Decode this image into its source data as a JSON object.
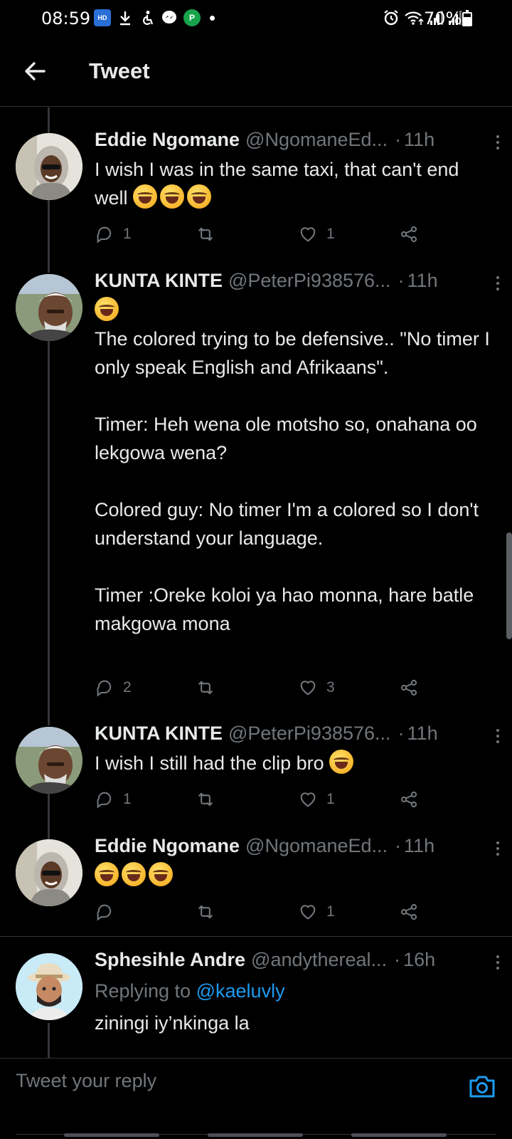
{
  "status_bar": {
    "time": "08:59",
    "app_icons": [
      "hd-movies-icon",
      "download-icon",
      "accessibility-icon",
      "messenger-icon",
      "p-app-icon"
    ],
    "battery": "70%",
    "battery_level": 0.7
  },
  "header": {
    "back_icon": "arrow-left-icon",
    "title": "Tweet"
  },
  "tweets": [
    {
      "name": "Eddie Ngomane",
      "handle": "@NgomaneEd...",
      "time": "11h",
      "text": "I wish I was in the same taxi, that can't end well",
      "emojis": 3,
      "replies": "1",
      "retweets": "",
      "likes": "1"
    },
    {
      "name": "KUNTA KINTE",
      "handle": "@PeterPi938576...",
      "time": "11h",
      "text": "The colored trying to be defensive.. \"No timer I only speak English and Afrikaans\".\n\nTimer: Heh wena ole motsho so, onahana oo lekgowa wena?\n\nColored guy: No timer I'm a colored so I don't understand your language.\n\nTimer :Oreke koloi ya hao monna, hare batle makgowa mona",
      "emojis": 1,
      "replies": "2",
      "retweets": "",
      "likes": "3"
    },
    {
      "name": "KUNTA KINTE",
      "handle": "@PeterPi938576...",
      "time": "11h",
      "text": "I wish I still had the clip bro",
      "emojis": 1,
      "replies": "1",
      "retweets": "",
      "likes": "1"
    },
    {
      "name": "Eddie Ngomane",
      "handle": "@NgomaneEd...",
      "time": "11h",
      "text": "",
      "emojis": 3,
      "replies": "",
      "retweets": "",
      "likes": "1"
    },
    {
      "name": "Sphesihle Andre",
      "handle": "@andythereal...",
      "time": "16h",
      "replying_prefix": "Replying to",
      "replying_to": "@kaeluvly",
      "text": "ziningi iy’nkinga la"
    }
  ],
  "reply_bar": {
    "placeholder": "Tweet your reply",
    "camera_icon": "camera-icon"
  },
  "colors": {
    "background": "#000000",
    "text": "#e7e9ea",
    "muted": "#71767b",
    "accent": "#1d9bf0",
    "divider": "#2f3336"
  }
}
